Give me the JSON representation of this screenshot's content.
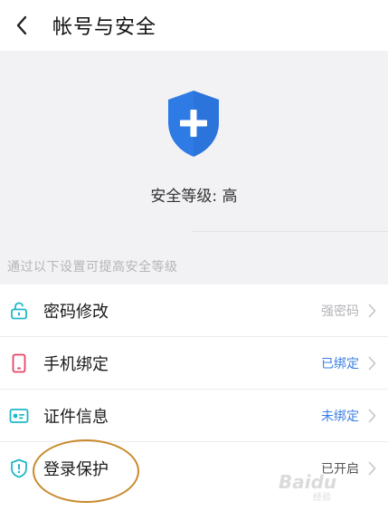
{
  "header": {
    "title": "帐号与安全",
    "back_icon": "chevron-left-icon"
  },
  "hero": {
    "shield_icon": "shield-plus-icon",
    "shield_color": "#2f7be5",
    "level_text": "安全等级: 高",
    "hint": "通过以下设置可提高安全等级"
  },
  "list": [
    {
      "id": "password",
      "icon": "lock-icon",
      "icon_color": "#1fb8c8",
      "label": "密码修改",
      "value": "强密码",
      "value_style": "grey"
    },
    {
      "id": "phone",
      "icon": "phone-icon",
      "icon_color": "#e6456a",
      "label": "手机绑定",
      "value": "已绑定",
      "value_style": "blue"
    },
    {
      "id": "id-info",
      "icon": "id-card-icon",
      "icon_color": "#1fb8c8",
      "label": "证件信息",
      "value": "未绑定",
      "value_style": "blue"
    },
    {
      "id": "login-protect",
      "icon": "shield-alert-icon",
      "icon_color": "#1fb8c8",
      "label": "登录保护",
      "value": "已开启",
      "value_style": "dark"
    }
  ],
  "colors": {
    "annotation": "#c98a2e",
    "accent_blue": "#3a7ee6"
  },
  "watermark": {
    "text": "Baidu",
    "sub": "经验"
  }
}
